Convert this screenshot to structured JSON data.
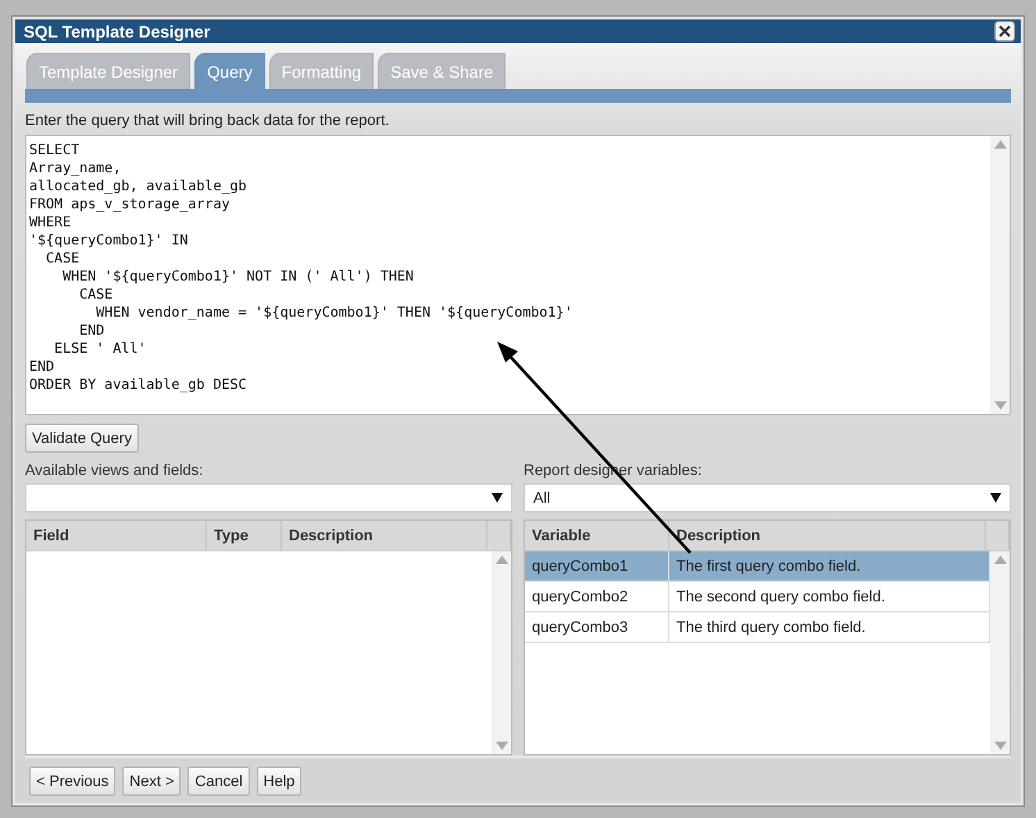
{
  "window": {
    "title": "SQL Template Designer"
  },
  "tabs": [
    {
      "label": "Template Designer",
      "selected": false
    },
    {
      "label": "Query",
      "selected": true
    },
    {
      "label": "Formatting",
      "selected": false
    },
    {
      "label": "Save & Share",
      "selected": false
    }
  ],
  "instruction": "Enter the query that will bring back data for the report.",
  "query": "SELECT\nArray_name,\nallocated_gb, available_gb\nFROM aps_v_storage_array\nWHERE\n'${queryCombo1}' IN\n  CASE\n    WHEN '${queryCombo1}' NOT IN (' All') THEN\n      CASE\n        WHEN vendor_name = '${queryCombo1}' THEN '${queryCombo1}'\n      END\n   ELSE ' All'\nEND\nORDER BY available_gb DESC",
  "validate_button": "Validate Query",
  "fields_panel": {
    "label": "Available views and fields:",
    "columns": [
      "Field",
      "Type",
      "Description"
    ]
  },
  "variables_panel": {
    "label": "Report designer variables:",
    "select_value": "All",
    "columns": [
      "Variable",
      "Description"
    ],
    "rows": [
      {
        "variable": "queryCombo1",
        "description": "The first query combo field.",
        "selected": true
      },
      {
        "variable": "queryCombo2",
        "description": "The second query combo field.",
        "selected": false
      },
      {
        "variable": "queryCombo3",
        "description": "The third query combo field.",
        "selected": false
      }
    ]
  },
  "buttons": [
    "< Previous",
    "Next >",
    "Cancel",
    "Help"
  ]
}
